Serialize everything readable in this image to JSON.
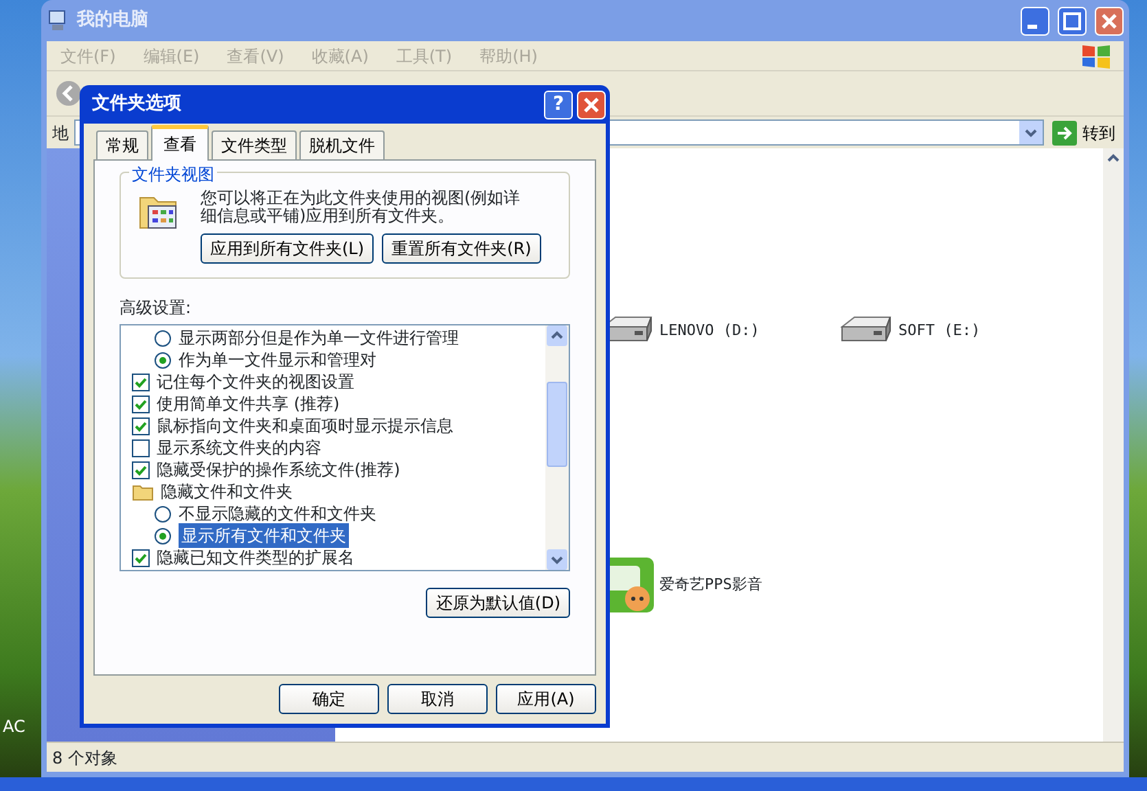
{
  "desktop": {
    "icon_labels": [
      "AC"
    ]
  },
  "window": {
    "title": "我的电脑",
    "menu": [
      "文件(F)",
      "编辑(E)",
      "查看(V)",
      "收藏(A)",
      "工具(T)",
      "帮助(H)"
    ],
    "address_label": "地",
    "go_button": "转到",
    "items": [
      {
        "kind": "drive",
        "label": "LENOVO (D:)"
      },
      {
        "kind": "drive",
        "label": "SOFT (E:)"
      },
      {
        "kind": "app",
        "label": "爱奇艺PPS影音"
      }
    ],
    "status_bar": "8 个对象"
  },
  "dialog": {
    "title": "文件夹选项",
    "help_button": "?",
    "tabs": [
      {
        "label": "常规",
        "selected": false
      },
      {
        "label": "查看",
        "selected": true
      },
      {
        "label": "文件类型",
        "selected": false
      },
      {
        "label": "脱机文件",
        "selected": false
      }
    ],
    "group_title": "文件夹视图",
    "group_text": "您可以将正在为此文件夹使用的视图(例如详细信息或平铺)应用到所有文件夹。",
    "group_buttons": [
      "应用到所有文件夹(L)",
      "重置所有文件夹(R)"
    ],
    "advanced_label": "高级设置:",
    "settings": [
      {
        "kind": "radio",
        "label": "显示两部分但是作为单一文件进行管理",
        "checked": false,
        "selected": false
      },
      {
        "kind": "radio",
        "label": "作为单一文件显示和管理对",
        "checked": true,
        "selected": false
      },
      {
        "kind": "checkbox",
        "label": "记住每个文件夹的视图设置",
        "checked": true,
        "selected": false
      },
      {
        "kind": "checkbox",
        "label": "使用简单文件共享 (推荐)",
        "checked": true,
        "selected": false
      },
      {
        "kind": "checkbox",
        "label": "鼠标指向文件夹和桌面项时显示提示信息",
        "checked": true,
        "selected": false
      },
      {
        "kind": "checkbox",
        "label": "显示系统文件夹的内容",
        "checked": false,
        "selected": false
      },
      {
        "kind": "checkbox",
        "label": "隐藏受保护的操作系统文件(推荐)",
        "checked": true,
        "selected": false
      },
      {
        "kind": "folder",
        "label": "隐藏文件和文件夹",
        "selected": false,
        "children": [
          {
            "kind": "radio",
            "label": "不显示隐藏的文件和文件夹",
            "checked": false,
            "selected": false
          },
          {
            "kind": "radio",
            "label": "显示所有文件和文件夹",
            "checked": true,
            "selected": true
          }
        ]
      },
      {
        "kind": "checkbox",
        "label": "隐藏已知文件类型的扩展名",
        "checked": true,
        "selected": false
      }
    ],
    "restore_button": "还原为默认值(D)",
    "buttons": [
      "确定",
      "取消",
      "应用(A)"
    ]
  }
}
